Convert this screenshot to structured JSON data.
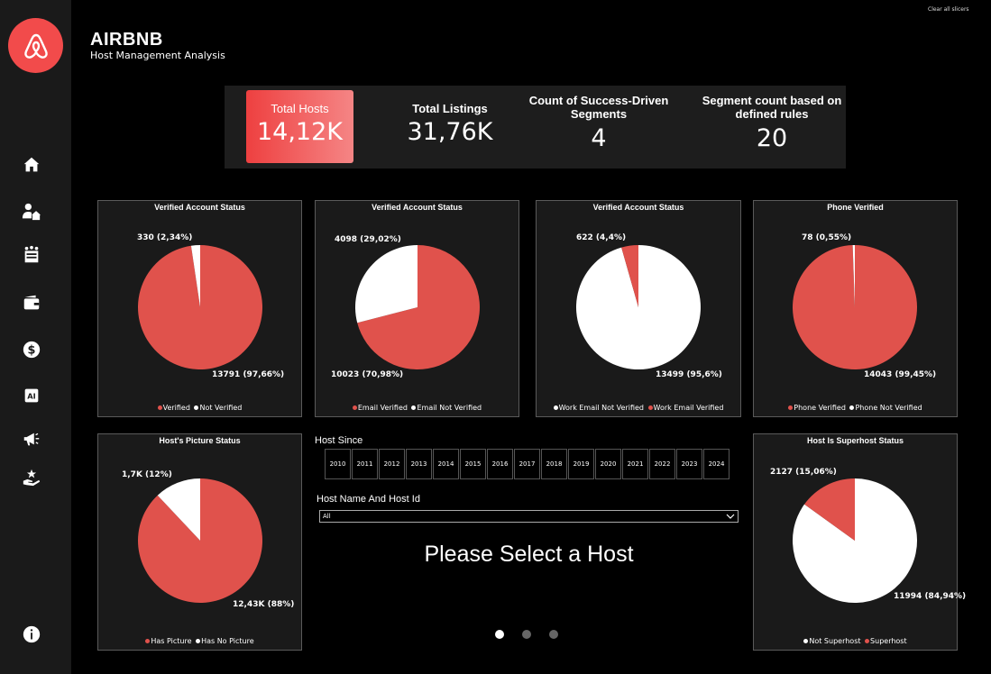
{
  "header": {
    "title": "AIRBNB",
    "subtitle": "Host Management Analysis",
    "clear_slicers": "Clear all slicers"
  },
  "sidebar": {
    "items": [
      {
        "icon": "home-icon"
      },
      {
        "icon": "host-home-icon"
      },
      {
        "icon": "amenities-icon"
      },
      {
        "icon": "wallet-icon"
      },
      {
        "icon": "dollar-icon"
      },
      {
        "icon": "ai-icon"
      },
      {
        "icon": "megaphone-icon"
      },
      {
        "icon": "star-hand-icon"
      },
      {
        "icon": "info-icon"
      }
    ]
  },
  "kpis": [
    {
      "label": "Total Hosts",
      "value": "14,12K",
      "active": true
    },
    {
      "label": "Total Listings",
      "value": "31,76K"
    },
    {
      "label": "Count of Success-Driven Segments",
      "value": "4"
    },
    {
      "label": "Segment count based on defined rules",
      "value": "20"
    }
  ],
  "colors": {
    "red": "#e0524c",
    "white": "#ffffff",
    "accent": "#f24b4b"
  },
  "charts": {
    "verified_account": {
      "title": "Verified Account Status",
      "slices": [
        {
          "name": "Verified",
          "value": 13791,
          "label": "13791 (97,66%)",
          "color": "#e0524c"
        },
        {
          "name": "Not Verified",
          "value": 330,
          "label": "330 (2,34%)",
          "color": "#ffffff"
        }
      ]
    },
    "email_verified": {
      "title": "Verified Account Status",
      "slices": [
        {
          "name": "Email Verified",
          "value": 10023,
          "label": "10023 (70,98%)",
          "color": "#e0524c"
        },
        {
          "name": "Email Not Verified",
          "value": 4098,
          "label": "4098 (29,02%)",
          "color": "#ffffff"
        }
      ]
    },
    "work_email": {
      "title": "Verified Account Status",
      "slices": [
        {
          "name": "Work Email Not Verified",
          "value": 13499,
          "label": "13499 (95,6%)",
          "color": "#ffffff"
        },
        {
          "name": "Work Email Verified",
          "value": 622,
          "label": "622 (4,4%)",
          "color": "#e0524c"
        }
      ]
    },
    "phone_verified": {
      "title": "Phone Verified",
      "slices": [
        {
          "name": "Phone Verified",
          "value": 14043,
          "label": "14043 (99,45%)",
          "color": "#e0524c"
        },
        {
          "name": "Phone Not Verified",
          "value": 78,
          "label": "78 (0,55%)",
          "color": "#ffffff"
        }
      ]
    },
    "picture": {
      "title": "Host's Picture Status",
      "slices": [
        {
          "name": "Has Picture",
          "value": 88,
          "label": "12,43K (88%)",
          "color": "#e0524c"
        },
        {
          "name": "Has No Picture",
          "value": 12,
          "label": "1,7K (12%)",
          "color": "#ffffff"
        }
      ]
    },
    "superhost": {
      "title": "Host Is Superhost Status",
      "slices": [
        {
          "name": "Not Superhost",
          "value": 11994,
          "label": "11994 (84,94%)",
          "color": "#ffffff"
        },
        {
          "name": "Superhost",
          "value": 2127,
          "label": "2127 (15,06%)",
          "color": "#e0524c"
        }
      ]
    }
  },
  "chart_data": [
    {
      "type": "pie",
      "title": "Verified Account Status",
      "categories": [
        "Verified",
        "Not Verified"
      ],
      "values": [
        13791,
        330
      ]
    },
    {
      "type": "pie",
      "title": "Verified Account Status",
      "categories": [
        "Email Verified",
        "Email Not Verified"
      ],
      "values": [
        10023,
        4098
      ]
    },
    {
      "type": "pie",
      "title": "Verified Account Status",
      "categories": [
        "Work Email Not Verified",
        "Work Email Verified"
      ],
      "values": [
        13499,
        622
      ]
    },
    {
      "type": "pie",
      "title": "Phone Verified",
      "categories": [
        "Phone Verified",
        "Phone Not Verified"
      ],
      "values": [
        14043,
        78
      ]
    },
    {
      "type": "pie",
      "title": "Host's Picture Status",
      "categories": [
        "Has Picture",
        "Has No Picture"
      ],
      "values": [
        12430,
        1700
      ]
    },
    {
      "type": "pie",
      "title": "Host Is Superhost Status",
      "categories": [
        "Not Superhost",
        "Superhost"
      ],
      "values": [
        11994,
        2127
      ]
    }
  ],
  "filters": {
    "host_since_label": "Host Since",
    "years": [
      "2010",
      "2011",
      "2012",
      "2013",
      "2014",
      "2015",
      "2016",
      "2017",
      "2018",
      "2019",
      "2020",
      "2021",
      "2022",
      "2023",
      "2024"
    ],
    "host_name_label": "Host Name And Host Id",
    "host_name_value": "All"
  },
  "message": "Please Select a Host",
  "pagination": {
    "current": 1,
    "total": 3
  }
}
